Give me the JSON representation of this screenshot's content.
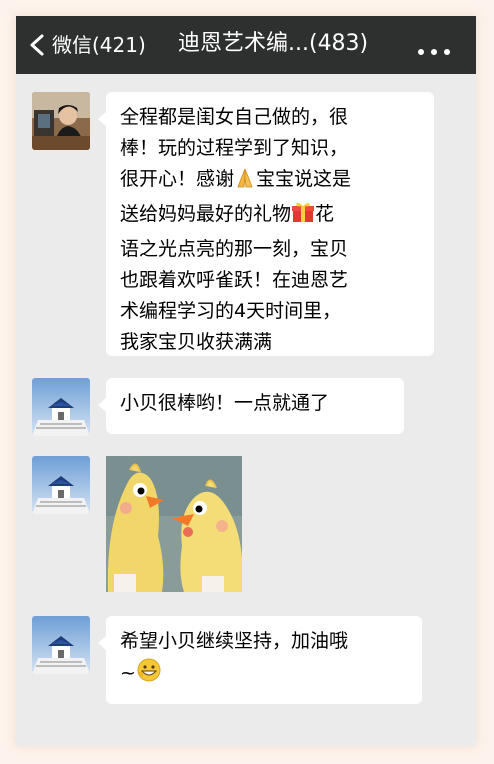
{
  "navbar": {
    "back_label": "微信(421)",
    "title": "迪恩艺术编...(483)"
  },
  "messages": [
    {
      "type": "text",
      "lines": [
        "全程都是闺女自己做的，很",
        "棒！玩的过程学到了知识，",
        "很开心！感谢",
        "宝宝说这是",
        "送给妈妈最好的礼物",
        "花",
        "语之光点亮的那一刻，宝贝",
        "也跟着欢呼雀跃！在迪恩艺",
        "术编程学习的4天时间里，",
        "我家宝贝收获满满"
      ]
    },
    {
      "type": "text",
      "text": "小贝很棒哟！一点就通了"
    },
    {
      "type": "image"
    },
    {
      "type": "text",
      "lines": [
        "希望小贝继续坚持，加油哦",
        "~"
      ]
    }
  ],
  "icons": {
    "back": "chevron-left-icon",
    "more": "more-dots-icon",
    "pray": "folded-hands-emoji",
    "gift": "gift-emoji",
    "grin": "grinning-face-emoji"
  },
  "colors": {
    "navbar": "#2e302f",
    "chat_bg": "#ebebeb",
    "bubble": "#ffffff"
  }
}
